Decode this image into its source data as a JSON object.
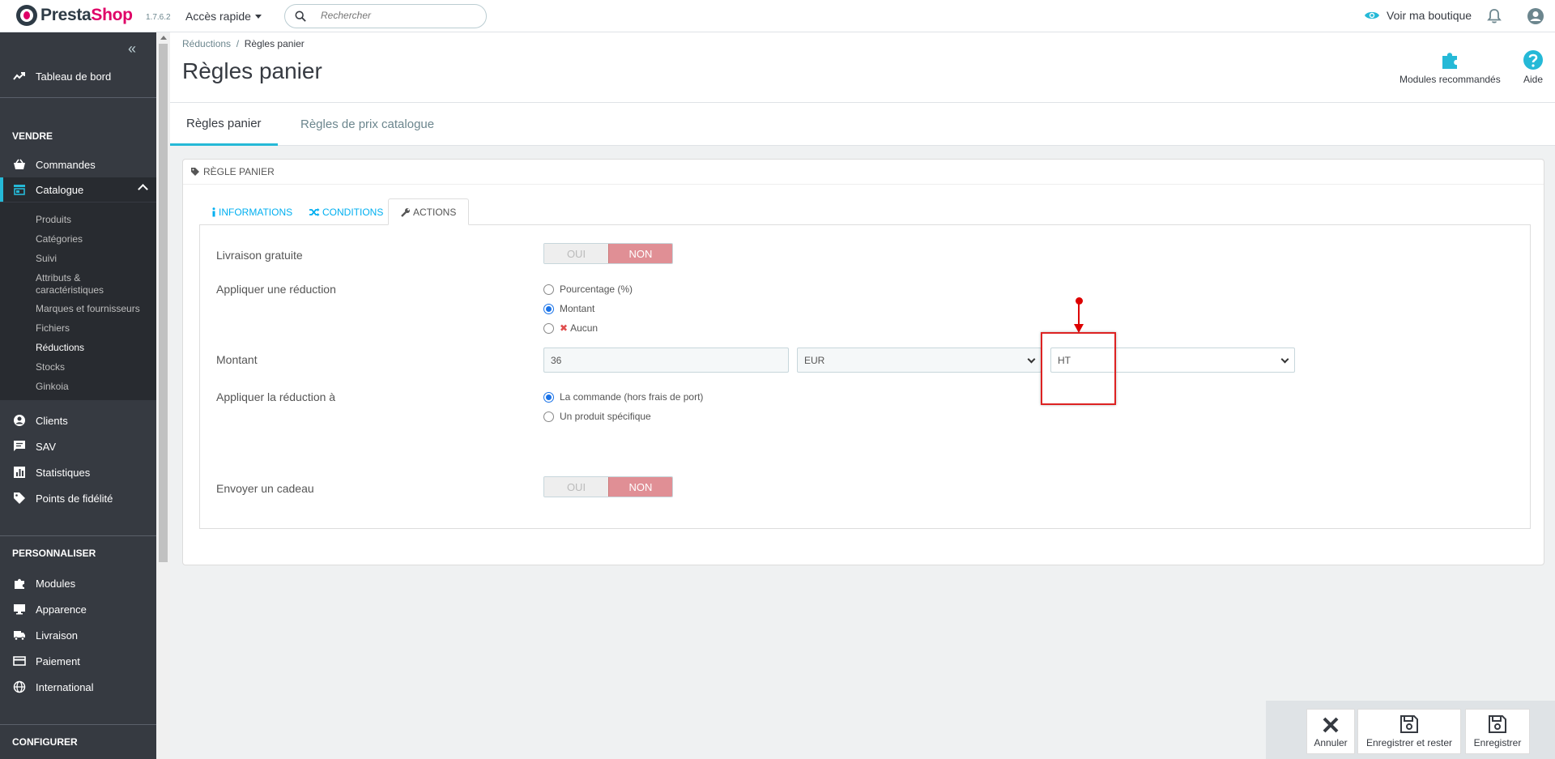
{
  "header": {
    "brand_part1": "Presta",
    "brand_part2": "Shop",
    "version": "1.7.6.2",
    "quick_access": "Accès rapide",
    "search_placeholder": "Rechercher",
    "view_shop": "Voir ma boutique"
  },
  "sidebar": {
    "collapse_glyph": "«",
    "dashboard": "Tableau de bord",
    "sections": {
      "sell": "VENDRE",
      "customize": "PERSONNALISER",
      "configure": "CONFIGURER"
    },
    "sell_items": [
      "Commandes",
      "Catalogue",
      "Clients",
      "SAV",
      "Statistiques",
      "Points de fidélité"
    ],
    "catalogue_sub": [
      "Produits",
      "Catégories",
      "Suivi",
      "Attributs &",
      "caractéristiques",
      "Marques et fournisseurs",
      "Fichiers",
      "Réductions",
      "Stocks",
      "Ginkoia"
    ],
    "customize_items": [
      "Modules",
      "Apparence",
      "Livraison",
      "Paiement",
      "International"
    ]
  },
  "page": {
    "breadcrumb_parent": "Réductions",
    "breadcrumb_sep": "/",
    "breadcrumb_current": "Règles panier",
    "title": "Règles panier",
    "recommended_modules": "Modules recommandés",
    "help": "Aide",
    "tabs": [
      "Règles panier",
      "Règles de prix catalogue"
    ]
  },
  "panel": {
    "heading": "RÈGLE PANIER",
    "tabs": [
      "INFORMATIONS",
      "CONDITIONS",
      "ACTIONS"
    ],
    "free_shipping_label": "Livraison gratuite",
    "yes": "OUI",
    "no": "NON",
    "apply_discount_label": "Appliquer une réduction",
    "discount_options": [
      "Pourcentage (%)",
      "Montant",
      "Aucun"
    ],
    "amount_label": "Montant",
    "amount_value": "36",
    "currency": "EUR",
    "tax": "HT",
    "apply_to_label": "Appliquer la réduction à",
    "apply_to_options": [
      "La commande (hors frais de port)",
      "Un produit spécifique"
    ],
    "gift_label": "Envoyer un cadeau"
  },
  "footer": {
    "cancel": "Annuler",
    "save_stay": "Enregistrer et rester",
    "save": "Enregistrer"
  },
  "colors": {
    "accent": "#25b9d7",
    "brand_pink": "#df0067",
    "sidebar_bg": "#363a41",
    "no_toggle": "#e08f95",
    "annotation": "#dd2222"
  }
}
